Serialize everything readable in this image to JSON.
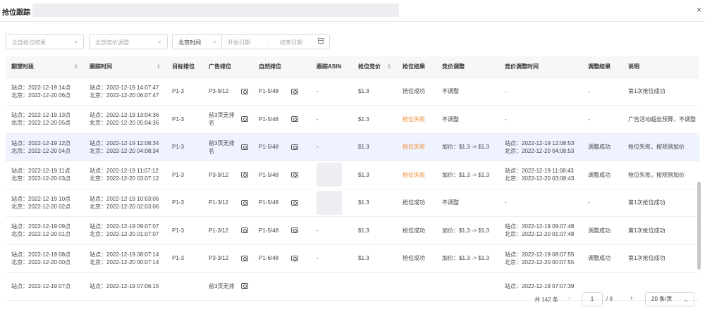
{
  "header": {
    "title": "抢位跟踪",
    "close": "×"
  },
  "filters": {
    "result_placeholder": "全部抢位结果",
    "adjust_placeholder": "全部竞价调整",
    "time_type": "北京时间",
    "start_placeholder": "开始日期",
    "sep": "-",
    "end_placeholder": "结束日期"
  },
  "table": {
    "columns": [
      "期望时段",
      "跟踪时间",
      "目标排位",
      "广告排位",
      "自然排位",
      "跟踪ASIN",
      "抢位竞价",
      "抢位结果",
      "竞价调整",
      "竞价调整时间",
      "调整结果",
      "说明"
    ],
    "rows": [
      {
        "exp1": "站点：2022-12-19 14点",
        "exp2": "北京：2022-12-20 06点",
        "trk1": "站点：2022-12-19 14:07:47",
        "trk2": "北京：2022-12-20 06:07:47",
        "target": "P1-3",
        "ad": "P3-9/12",
        "natural": "P1-5/48",
        "asin": "-",
        "bid": "$1.3",
        "result": "抢位成功",
        "adjust": "不调整",
        "adj1": "-",
        "adj2": "",
        "adjres": "-",
        "note": "第1次抢位成功"
      },
      {
        "exp1": "站点：2022-12-19 13点",
        "exp2": "北京：2022-12-20 05点",
        "trk1": "站点：2022-12-19 13:04:36",
        "trk2": "北京：2022-12-20 05:04:36",
        "target": "P1-3",
        "ad": "前3页无排名",
        "natural": "P1-5/48",
        "asin": "-",
        "bid": "$1.3",
        "result": "抢位失败",
        "adjust": "不调整",
        "adj1": "-",
        "adj2": "",
        "adjres": "-",
        "note": "广告活动超出预算，不调整"
      },
      {
        "exp1": "站点：2022-12-19 12点",
        "exp2": "北京：2022-12-20 04点",
        "trk1": "站点：2022-12-19 12:08:34",
        "trk2": "北京：2022-12-20 04:08:34",
        "target": "P1-3",
        "ad": "前3页无排名",
        "natural": "P1-5/48",
        "asin": "-",
        "bid": "$1.3",
        "result": "抢位失败",
        "adjust": "加价：$1.3 -> $1.3",
        "adj1": "站点：2022-12-19 12:08:53",
        "adj2": "北京：2022-12-20 04:08:53",
        "adjres": "调整成功",
        "note": "抢位失败，按规则加价"
      },
      {
        "exp1": "站点：2022-12-19 11点",
        "exp2": "北京：2022-12-20 03点",
        "trk1": "站点：2022-12-19 11:07:12",
        "trk2": "北京：2022-12-20 03:07:12",
        "target": "P1-3",
        "ad": "P3-9/12",
        "natural": "P1-5/48",
        "asin": "",
        "bid": "$1.3",
        "result": "抢位失败",
        "adjust": "加价：$1.3 -> $1.3",
        "adj1": "站点：2022-12-19 11:08:43",
        "adj2": "北京：2022-12-20 03:08:43",
        "adjres": "调整成功",
        "note": "抢位失败，按规则加价"
      },
      {
        "exp1": "站点：2022-12-19 10点",
        "exp2": "北京：2022-12-20 02点",
        "trk1": "站点：2022-12-19 10:03:06",
        "trk2": "北京：2022-12-20 02:03:06",
        "target": "P1-3",
        "ad": "P1-3/12",
        "natural": "P1-5/48",
        "asin": "",
        "bid": "$1.3",
        "result": "抢位成功",
        "adjust": "不调整",
        "adj1": "-",
        "adj2": "",
        "adjres": "-",
        "note": "第1次抢位成功"
      },
      {
        "exp1": "站点：2022-12-19 09点",
        "exp2": "北京：2022-12-20 01点",
        "trk1": "站点：2022-12-19 09:07:07",
        "trk2": "北京：2022-12-20 01:07:07",
        "target": "P1-3",
        "ad": "P1-3/12",
        "natural": "P1-5/48",
        "asin": "-",
        "bid": "$1.3",
        "result": "抢位成功",
        "adjust": "加价：$1.3 -> $1.3",
        "adj1": "站点：2022-12-19 09:07:48",
        "adj2": "北京：2022-12-20 01:07:48",
        "adjres": "调整成功",
        "note": "第1次抢位成功"
      },
      {
        "exp1": "站点：2022-12-19 08点",
        "exp2": "北京：2022-12-20 00点",
        "trk1": "站点：2022-12-19 08:07:14",
        "trk2": "北京：2022-12-20 00:07:14",
        "target": "P1-3",
        "ad": "P3-3/12",
        "natural": "P1-6/48",
        "asin": "-",
        "bid": "$1.3",
        "result": "抢位成功",
        "adjust": "加价：$1.3 -> $1.3",
        "adj1": "站点：2022-12-19 08:07:55",
        "adj2": "北京：2022-12-20 00:07:55",
        "adjres": "调整成功",
        "note": "第1次抢位成功"
      },
      {
        "exp1": "站点：2022-12-19 07点",
        "exp2": "",
        "trk1": "站点：2022-12-19 07:06:15",
        "trk2": "",
        "target": "",
        "ad": "前3页无排",
        "natural": "",
        "asin": "",
        "bid": "",
        "result": "",
        "adjust": "",
        "adj1": "站点：2022-12-19 07:07:39",
        "adj2": "",
        "adjres": "",
        "note": ""
      }
    ]
  },
  "pagination": {
    "total": "共 142 条",
    "current": "1",
    "of": "/ 8",
    "page_size": "20 条/页"
  }
}
